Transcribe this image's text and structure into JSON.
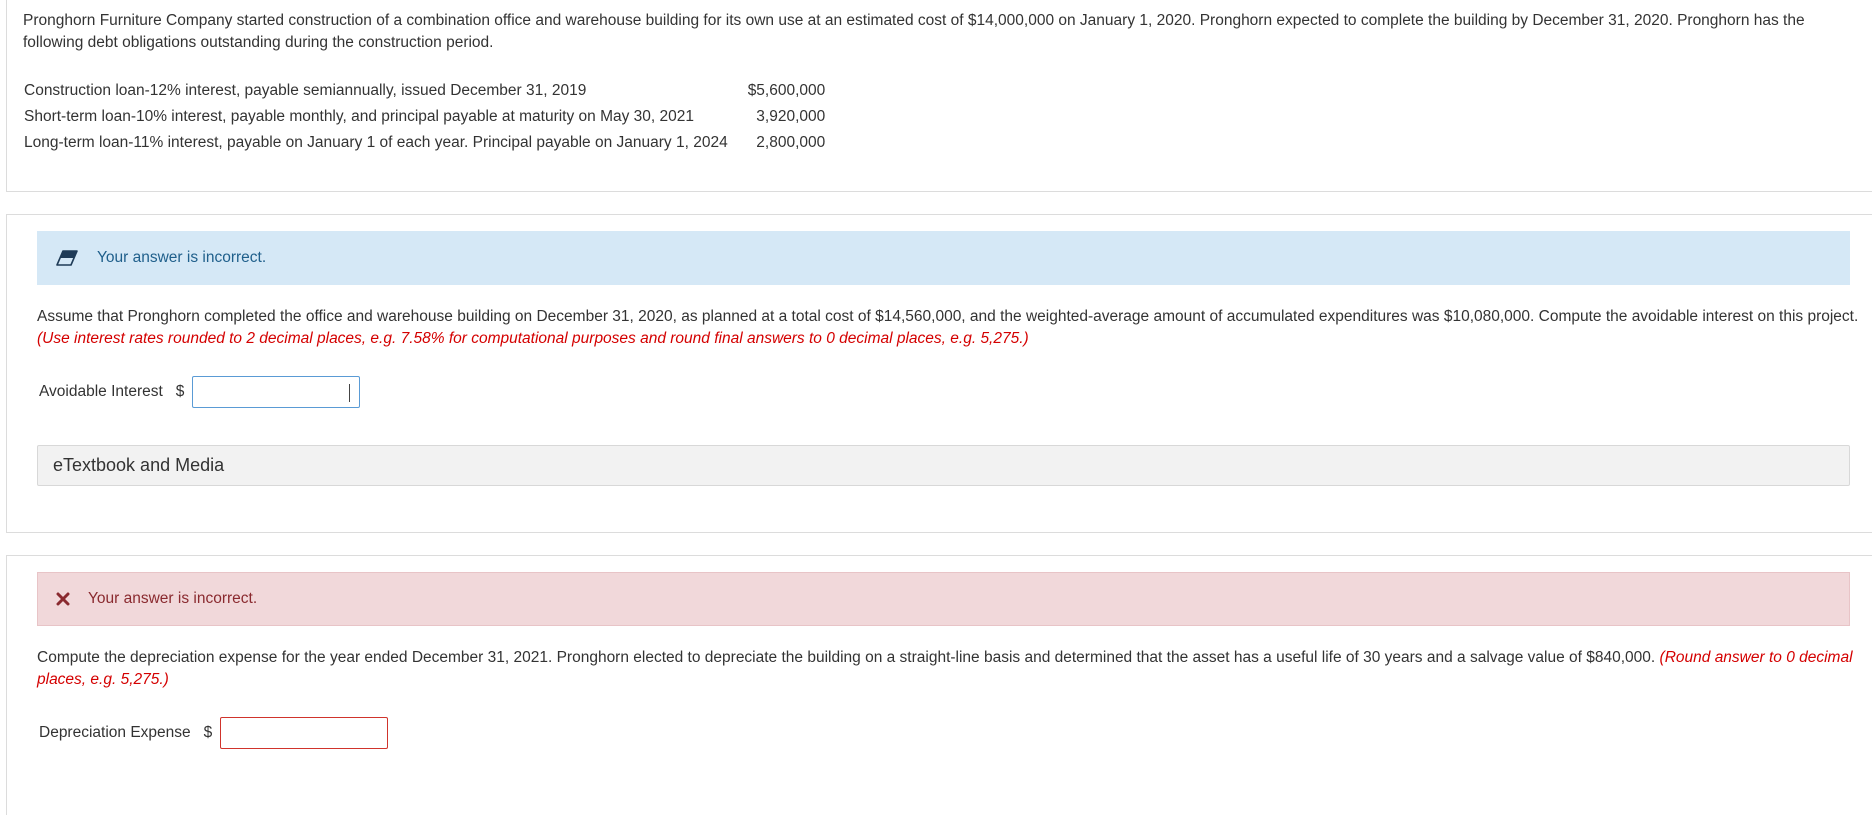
{
  "intro": {
    "text": "Pronghorn Furniture Company started construction of a combination office and warehouse building for its own use at an estimated cost of $14,000,000 on January 1, 2020. Pronghorn expected to complete the building by December 31, 2020. Pronghorn has the following debt obligations outstanding during the construction period."
  },
  "debts": [
    {
      "description": "Construction loan-12% interest, payable semiannually, issued December 31, 2019",
      "amount": "$5,600,000"
    },
    {
      "description": "Short-term loan-10% interest, payable monthly, and principal payable at maturity on May 30, 2021",
      "amount": "3,920,000"
    },
    {
      "description": "Long-term loan-11% interest, payable on January 1 of each  year. Principal payable on January 1, 2024",
      "amount": "2,800,000"
    }
  ],
  "part_a": {
    "feedback": "Your answer is incorrect.",
    "question": "Assume that Pronghorn completed the office and warehouse building on December 31, 2020, as planned at a total cost of $14,560,000, and the weighted-average amount of accumulated expenditures was $10,080,000. Compute the avoidable interest on this project.",
    "hint": "(Use interest rates rounded to 2 decimal places, e.g. 7.58% for computational purposes and round final answers to 0 decimal places, e.g. 5,275.)",
    "field_label": "Avoidable Interest",
    "currency": "$",
    "value": "",
    "etextbook_label": "eTextbook and Media"
  },
  "part_b": {
    "feedback": "Your answer is incorrect.",
    "question": "Compute the depreciation expense for the year ended December 31, 2021. Pronghorn elected to depreciate the building on a straight-line basis and determined that the asset has a useful life of 30 years and a salvage value of $840,000.",
    "hint": "(Round answer to 0 decimal places, e.g. 5,275.)",
    "field_label": "Depreciation Expense",
    "currency": "$",
    "value": ""
  },
  "icons": {
    "part_a_feedback": "eraser-icon",
    "part_b_feedback": "x-mark-icon"
  },
  "colors": {
    "info_banner_bg": "#d5e8f6",
    "error_banner_bg": "#f1d8da",
    "hint_red": "#d40000",
    "input_focus_border": "#5a9bd5",
    "input_error_border": "#d0342c"
  }
}
